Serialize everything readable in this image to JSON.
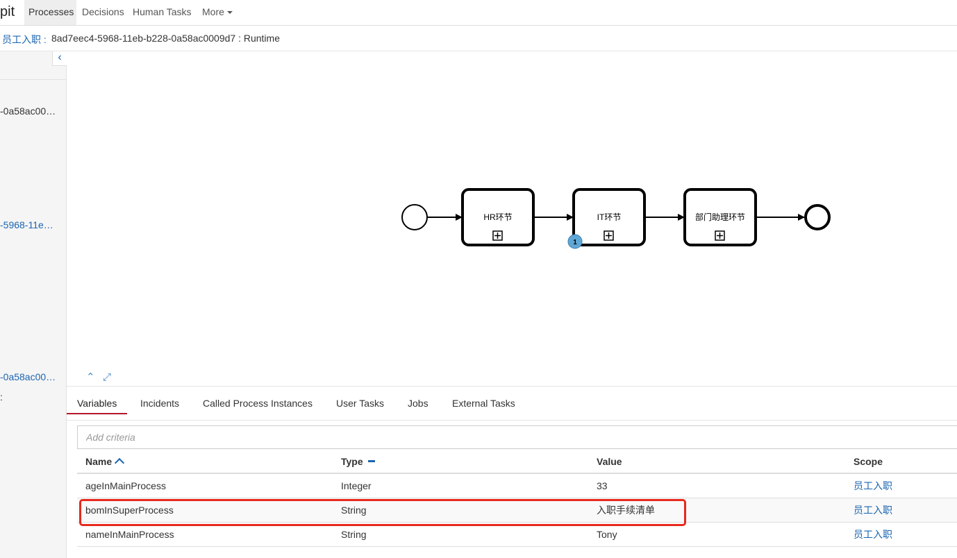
{
  "topbar": {
    "brand": "pit",
    "nav": [
      {
        "label": "Processes",
        "active": true
      },
      {
        "label": "Decisions",
        "active": false
      },
      {
        "label": "Human Tasks",
        "active": false
      },
      {
        "label": "More",
        "active": false
      }
    ]
  },
  "breadcrumb": {
    "process_link": "员工入职 :",
    "instance_text": "8ad7eec4-5968-11eb-b228-0a58ac0009d7 : Runtime"
  },
  "sidebar": {
    "toggle_icon": "chevron-left-icon",
    "values": [
      {
        "text": "-0a58ac00…",
        "link": false
      },
      {
        "text": "-5968-11e…",
        "link": true
      },
      {
        "text": "-0a58ac00…",
        "link": true
      },
      {
        "text": ":",
        "link": false
      }
    ]
  },
  "diagram": {
    "tasks": [
      {
        "label": "HR环节"
      },
      {
        "label": "IT环节",
        "badge": "1"
      },
      {
        "label": "部门助理环节"
      }
    ],
    "controls": {
      "collapse_icon": "chevron-up-icon",
      "fullscreen_icon": "expand-icon"
    }
  },
  "tabs": [
    {
      "label": "Variables",
      "active": true
    },
    {
      "label": "Incidents",
      "active": false
    },
    {
      "label": "Called Process Instances",
      "active": false
    },
    {
      "label": "User Tasks",
      "active": false
    },
    {
      "label": "Jobs",
      "active": false
    },
    {
      "label": "External Tasks",
      "active": false
    }
  ],
  "criteria": {
    "placeholder": "Add criteria"
  },
  "table": {
    "headers": {
      "name": "Name",
      "type": "Type",
      "value": "Value",
      "scope": "Scope"
    },
    "rows": [
      {
        "name": "ageInMainProcess",
        "type": "Integer",
        "value": "33",
        "scope": "员工入职"
      },
      {
        "name": "bomInSuperProcess",
        "type": "String",
        "value": "入职手续清单",
        "scope": "员工入职"
      },
      {
        "name": "nameInMainProcess",
        "type": "String",
        "value": "Tony",
        "scope": "员工入职"
      }
    ]
  },
  "colors": {
    "link": "#1a64b0",
    "active_tab_underline": "#b5152b",
    "highlight": "#e8281e",
    "token": "#5fa7d6"
  }
}
